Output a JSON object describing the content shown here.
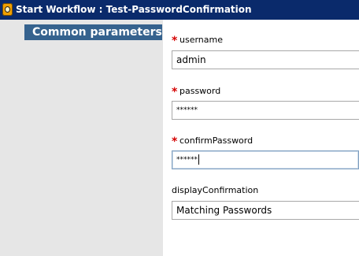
{
  "window": {
    "title": "Start Workflow : Test-PasswordConfirmation",
    "icon": "workflow-app-icon"
  },
  "section": {
    "label": "Common parameters"
  },
  "fields": [
    {
      "label": "username",
      "required": true,
      "value": "admin"
    },
    {
      "label": "password",
      "required": true,
      "value": "******"
    },
    {
      "label": "confirmPassword",
      "required": true,
      "value": "******",
      "focused": true
    },
    {
      "label": "displayConfirmation",
      "required": false,
      "value": "Matching Passwords"
    }
  ],
  "required_marker": "*",
  "colors": {
    "titlebar": "#0a2a6b",
    "section_tab": "#35628e",
    "required": "#d40000",
    "left_panel": "#e6e6e6"
  }
}
